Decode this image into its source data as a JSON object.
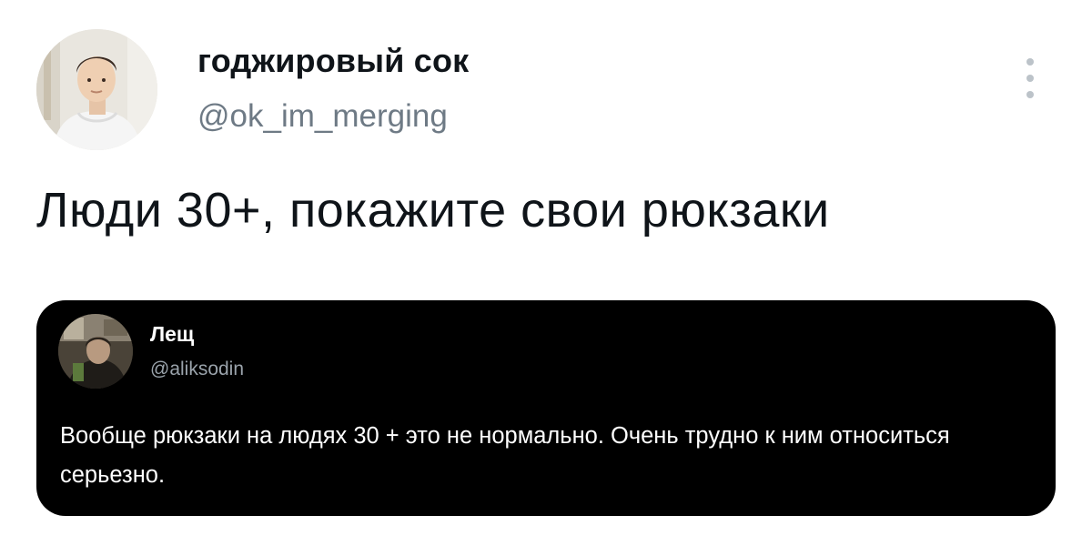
{
  "tweet": {
    "author": {
      "name": "годжировый сок",
      "handle": "@ok_im_merging",
      "avatar_icon": "profile-photo-man-in-white-hoodie"
    },
    "menu_icon": "more-vertical-icon",
    "text": "Люди 30+, покажите свои рюкзаки"
  },
  "quote": {
    "author": {
      "name": "Лещ",
      "handle": "@aliksodin",
      "avatar_icon": "profile-photo-dark"
    },
    "text": "Вообще рюкзаки на людях 30 + это не нормально. Очень трудно к ним относиться серьезно."
  },
  "colors": {
    "background": "#ffffff",
    "text": "#0f1419",
    "secondary_text": "#6e7a85",
    "quote_background": "#000000",
    "quote_text": "#ffffff",
    "quote_secondary_text": "#9aa3ab"
  }
}
